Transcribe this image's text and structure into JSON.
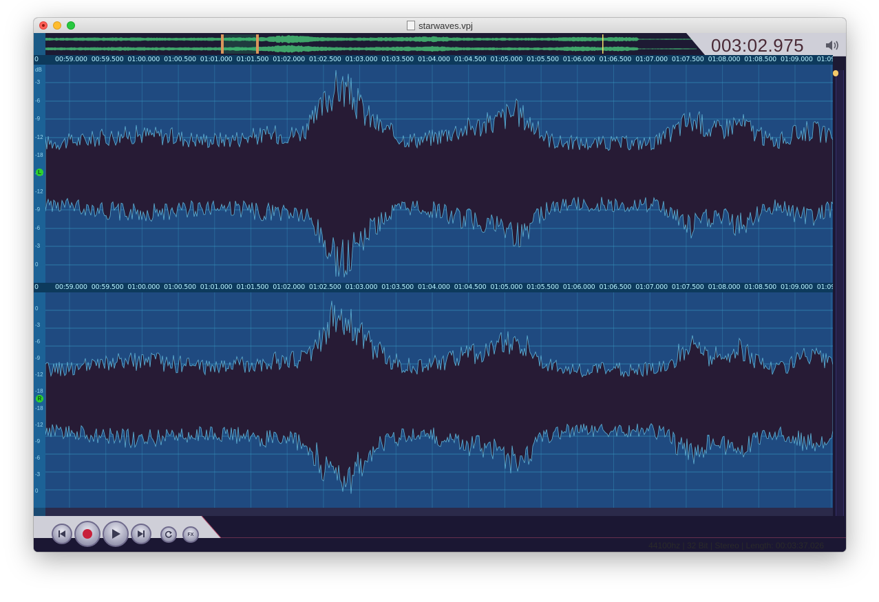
{
  "window": {
    "title": "starwaves.vpj"
  },
  "playback": {
    "time": "003:02.975"
  },
  "ruler": {
    "db_label": "dB",
    "first_partial": "0",
    "labels": [
      "00:59.000",
      "00:59.500",
      "01:00.000",
      "01:00.500",
      "01:01.000",
      "01:01.500",
      "01:02.000",
      "01:02.500",
      "01:03.000",
      "01:03.500",
      "01:04.000",
      "01:04.500",
      "01:05.000",
      "01:05.500",
      "01:06.000",
      "01:06.500",
      "01:07.000",
      "01:07.500",
      "01:08.000",
      "01:08.500",
      "01:09.000",
      "01:09"
    ]
  },
  "channels": [
    {
      "name": "left",
      "badge": "L",
      "ticks": [
        "-3",
        "-6",
        "-9",
        "-12",
        "-18",
        "-18",
        "-12",
        "-9",
        "-6",
        "-3",
        "0"
      ]
    },
    {
      "name": "right",
      "badge": "R",
      "ticks": [
        "0",
        "-3",
        "-6",
        "-9",
        "-12",
        "-18",
        "-18",
        "-12",
        "-9",
        "-6",
        "-3",
        "0"
      ]
    }
  ],
  "transport": {
    "buttons": [
      "skip-back",
      "record",
      "play",
      "skip-forward",
      "loop",
      "fx"
    ],
    "fx_label": "FX"
  },
  "status": {
    "info": "44100hz | 32 Bit | Stereo | Length: 00:03:37.026"
  },
  "colors": {
    "waveform_bg": "#1f4a80",
    "waveform_fill": "#271b35",
    "waveform_edge": "#5fb3d6",
    "grid": "#3aa0c8",
    "overview_wave": "#3fa46a",
    "time_panel": "#c9c9d3"
  },
  "icons": {
    "volume": "speaker-icon",
    "document": "document-icon"
  }
}
